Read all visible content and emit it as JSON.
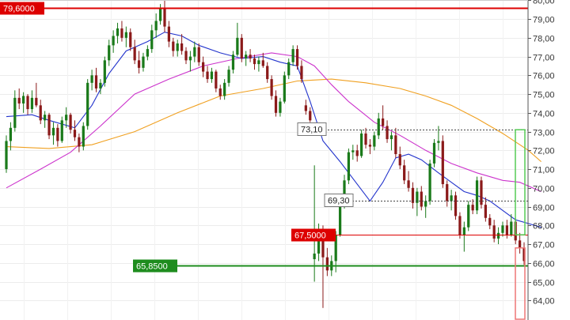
{
  "chart_data": {
    "type": "candlestick",
    "ylim": [
      63.0,
      80.1
    ],
    "y_ticks": [
      "64,00",
      "65,00",
      "66,00",
      "67,00",
      "68,00",
      "69,00",
      "70,00",
      "71,00",
      "72,00",
      "73,00",
      "74,00",
      "75,00",
      "76,00",
      "77,00",
      "78,00",
      "79,00",
      "80,00"
    ],
    "grid": true,
    "colors": {
      "up": "#1a7a1a",
      "down": "#8b1a1a",
      "sma_short": "#2233cc",
      "sma_mid": "#cc33cc",
      "sma_long": "#f0a020"
    },
    "annotations": {
      "resistance_high": {
        "value": 79.6,
        "label": "79,6000",
        "color": "#dd0000"
      },
      "resistance_mid": {
        "value": 67.5,
        "label": "67,5000",
        "color": "#dd0000"
      },
      "support": {
        "value": 65.85,
        "label": "65,8500",
        "color": "#1e8c1e"
      },
      "level_high": {
        "value": 73.1,
        "label": "73,10"
      },
      "level_low": {
        "value": 69.3,
        "label": "69,30"
      }
    },
    "candles": [
      [
        71.0,
        72.8,
        70.8,
        72.5
      ],
      [
        72.5,
        73.5,
        72.0,
        73.2
      ],
      [
        73.2,
        75.2,
        73.0,
        74.8
      ],
      [
        74.8,
        75.3,
        74.2,
        74.5
      ],
      [
        74.5,
        75.1,
        74.0,
        74.9
      ],
      [
        74.9,
        75.0,
        73.9,
        74.2
      ],
      [
        74.2,
        75.2,
        74.0,
        74.8
      ],
      [
        74.8,
        75.6,
        74.3,
        74.4
      ],
      [
        74.4,
        74.7,
        73.4,
        73.6
      ],
      [
        73.6,
        74.1,
        73.2,
        73.9
      ],
      [
        73.9,
        74.0,
        72.6,
        72.8
      ],
      [
        72.8,
        73.5,
        72.3,
        73.2
      ],
      [
        73.2,
        73.4,
        72.2,
        72.5
      ],
      [
        72.5,
        73.8,
        72.4,
        73.6
      ],
      [
        73.6,
        74.3,
        73.2,
        73.9
      ],
      [
        73.9,
        74.0,
        72.9,
        73.1
      ],
      [
        73.1,
        73.6,
        72.5,
        72.7
      ],
      [
        72.7,
        72.9,
        71.9,
        72.2
      ],
      [
        72.2,
        73.5,
        72.0,
        73.3
      ],
      [
        73.3,
        75.8,
        73.1,
        75.6
      ],
      [
        75.6,
        76.3,
        75.2,
        76.0
      ],
      [
        76.0,
        76.4,
        75.1,
        75.3
      ],
      [
        75.3,
        75.8,
        75.0,
        75.6
      ],
      [
        75.6,
        77.0,
        75.4,
        76.8
      ],
      [
        76.8,
        77.9,
        76.5,
        77.6
      ],
      [
        77.6,
        78.4,
        77.2,
        78.1
      ],
      [
        78.1,
        78.8,
        77.7,
        78.5
      ],
      [
        78.5,
        78.9,
        77.8,
        78.0
      ],
      [
        78.0,
        78.6,
        77.5,
        78.3
      ],
      [
        78.3,
        78.5,
        77.3,
        77.5
      ],
      [
        77.5,
        77.9,
        76.6,
        76.8
      ],
      [
        76.8,
        77.3,
        76.1,
        76.4
      ],
      [
        76.4,
        77.2,
        76.2,
        77.0
      ],
      [
        77.0,
        77.6,
        76.8,
        77.4
      ],
      [
        77.4,
        78.7,
        77.2,
        78.4
      ],
      [
        78.4,
        79.3,
        78.0,
        78.9
      ],
      [
        78.9,
        79.8,
        78.7,
        79.6
      ],
      [
        79.6,
        80.2,
        78.3,
        78.6
      ],
      [
        78.6,
        78.9,
        77.5,
        77.8
      ],
      [
        77.8,
        78.0,
        77.0,
        77.3
      ],
      [
        77.3,
        77.9,
        77.0,
        77.7
      ],
      [
        77.7,
        78.2,
        77.1,
        77.3
      ],
      [
        77.3,
        77.5,
        76.6,
        76.8
      ],
      [
        76.8,
        77.3,
        76.2,
        77.0
      ],
      [
        77.0,
        77.8,
        76.7,
        77.5
      ],
      [
        77.5,
        77.7,
        76.5,
        76.7
      ],
      [
        76.7,
        77.0,
        75.9,
        76.2
      ],
      [
        76.2,
        76.5,
        75.6,
        75.8
      ],
      [
        75.8,
        76.4,
        75.6,
        76.2
      ],
      [
        76.2,
        76.3,
        75.1,
        75.3
      ],
      [
        75.3,
        75.5,
        74.7,
        74.9
      ],
      [
        74.9,
        75.8,
        74.7,
        75.6
      ],
      [
        75.6,
        76.5,
        75.4,
        76.3
      ],
      [
        76.3,
        77.3,
        76.1,
        77.1
      ],
      [
        77.1,
        78.8,
        77.0,
        78.0
      ],
      [
        78.0,
        78.2,
        76.7,
        76.9
      ],
      [
        76.9,
        77.3,
        76.5,
        77.1
      ],
      [
        77.1,
        77.4,
        76.7,
        76.9
      ],
      [
        76.9,
        77.1,
        76.3,
        76.6
      ],
      [
        76.6,
        77.0,
        76.2,
        76.8
      ],
      [
        76.8,
        77.2,
        76.4,
        76.5
      ],
      [
        76.5,
        76.7,
        75.6,
        75.8
      ],
      [
        75.8,
        76.0,
        74.7,
        74.9
      ],
      [
        74.9,
        75.2,
        73.8,
        74.0
      ],
      [
        74.0,
        74.8,
        73.8,
        74.6
      ],
      [
        74.6,
        76.2,
        74.5,
        76.0
      ],
      [
        76.0,
        76.9,
        75.8,
        76.7
      ],
      [
        76.7,
        77.6,
        76.5,
        77.4
      ],
      [
        77.4,
        77.6,
        76.3,
        76.5
      ],
      [
        76.5,
        76.8,
        75.6,
        75.8
      ],
      [
        74.4,
        74.7,
        73.9,
        74.1
      ],
      [
        74.1,
        74.3,
        73.5,
        73.6
      ],
      [
        66.2,
        71.2,
        65.0,
        66.5
      ],
      [
        66.5,
        68.1,
        66.1,
        67.8
      ],
      [
        67.8,
        68.0,
        63.6,
        66.3
      ],
      [
        66.3,
        66.8,
        65.3,
        65.6
      ],
      [
        65.6,
        66.4,
        65.3,
        66.1
      ],
      [
        66.1,
        67.7,
        65.5,
        67.5
      ],
      [
        67.5,
        69.5,
        67.4,
        69.2
      ],
      [
        69.2,
        70.7,
        68.9,
        70.4
      ],
      [
        70.4,
        72.1,
        70.2,
        71.9
      ],
      [
        71.9,
        72.3,
        71.5,
        72.0
      ],
      [
        72.0,
        72.3,
        71.4,
        71.7
      ],
      [
        71.7,
        73.1,
        71.6,
        72.9
      ],
      [
        72.9,
        73.2,
        72.1,
        72.3
      ],
      [
        72.3,
        72.6,
        71.8,
        72.2
      ],
      [
        72.2,
        73.0,
        72.0,
        72.8
      ],
      [
        72.8,
        74.0,
        72.6,
        73.7
      ],
      [
        73.7,
        74.4,
        73.1,
        73.3
      ],
      [
        73.3,
        73.6,
        72.4,
        72.6
      ],
      [
        72.6,
        73.0,
        72.0,
        72.8
      ],
      [
        72.8,
        73.2,
        71.6,
        71.8
      ],
      [
        71.8,
        72.2,
        71.0,
        71.2
      ],
      [
        71.2,
        71.5,
        70.2,
        70.4
      ],
      [
        70.4,
        70.9,
        69.8,
        70.0
      ],
      [
        70.0,
        70.3,
        68.9,
        69.2
      ],
      [
        69.2,
        70.0,
        68.5,
        69.8
      ],
      [
        69.8,
        70.1,
        68.8,
        69.0
      ],
      [
        69.0,
        69.6,
        68.4,
        69.3
      ],
      [
        69.3,
        71.5,
        69.1,
        71.3
      ],
      [
        71.3,
        72.6,
        71.1,
        72.4
      ],
      [
        72.4,
        73.3,
        72.0,
        72.5
      ],
      [
        72.5,
        72.8,
        70.0,
        70.2
      ],
      [
        70.2,
        70.4,
        69.0,
        69.3
      ],
      [
        69.3,
        69.9,
        68.8,
        69.6
      ],
      [
        69.6,
        69.8,
        68.3,
        68.5
      ],
      [
        68.5,
        68.7,
        67.3,
        67.5
      ],
      [
        67.5,
        68.2,
        66.6,
        67.9
      ],
      [
        67.9,
        69.3,
        67.7,
        69.1
      ],
      [
        69.1,
        69.4,
        68.6,
        68.8
      ],
      [
        68.8,
        70.6,
        68.6,
        70.4
      ],
      [
        70.4,
        70.6,
        68.9,
        69.1
      ],
      [
        69.1,
        69.5,
        68.2,
        68.4
      ],
      [
        68.4,
        68.6,
        67.8,
        68.0
      ],
      [
        68.0,
        68.3,
        67.1,
        67.3
      ],
      [
        67.3,
        67.9,
        67.0,
        67.6
      ],
      [
        67.6,
        68.2,
        67.4,
        68.0
      ],
      [
        68.0,
        68.3,
        67.3,
        67.5
      ],
      [
        67.5,
        68.6,
        67.4,
        68.2
      ],
      [
        68.2,
        68.4,
        67.0,
        67.2
      ],
      [
        67.2,
        67.6,
        66.5,
        66.8
      ],
      [
        66.8,
        67.1,
        65.9,
        66.1
      ]
    ],
    "sma_short": [
      [
        0,
        73.8
      ],
      [
        6,
        73.9
      ],
      [
        10,
        73.6
      ],
      [
        16,
        73.2
      ],
      [
        20,
        74.4
      ],
      [
        24,
        76.1
      ],
      [
        28,
        77.3
      ],
      [
        33,
        77.8
      ],
      [
        37,
        78.3
      ],
      [
        41,
        78.1
      ],
      [
        45,
        77.6
      ],
      [
        50,
        77.2
      ],
      [
        55,
        76.9
      ],
      [
        60,
        77.0
      ],
      [
        64,
        76.7
      ],
      [
        68,
        76.5
      ],
      [
        71,
        74.6
      ],
      [
        74,
        72.5
      ],
      [
        78,
        71.4
      ],
      [
        82,
        70.2
      ],
      [
        85,
        69.3
      ],
      [
        88,
        70.3
      ],
      [
        91,
        71.6
      ],
      [
        94,
        71.8
      ],
      [
        97,
        71.5
      ],
      [
        101,
        70.8
      ],
      [
        104,
        70.3
      ],
      [
        107,
        69.8
      ],
      [
        110,
        69.6
      ],
      [
        113,
        69.3
      ],
      [
        116,
        68.8
      ],
      [
        119,
        68.3
      ],
      [
        122,
        68.1
      ],
      [
        125,
        67.9
      ]
    ],
    "sma_mid": [
      [
        0,
        70.0
      ],
      [
        8,
        71.0
      ],
      [
        15,
        71.9
      ],
      [
        22,
        73.3
      ],
      [
        30,
        75.0
      ],
      [
        38,
        75.8
      ],
      [
        46,
        76.5
      ],
      [
        54,
        76.9
      ],
      [
        62,
        77.2
      ],
      [
        68,
        77.0
      ],
      [
        72,
        76.5
      ],
      [
        76,
        75.5
      ],
      [
        80,
        74.6
      ],
      [
        86,
        73.5
      ],
      [
        92,
        72.8
      ],
      [
        98,
        72.0
      ],
      [
        104,
        71.3
      ],
      [
        110,
        70.8
      ],
      [
        116,
        70.4
      ],
      [
        120,
        70.3
      ],
      [
        125,
        69.8
      ]
    ],
    "sma_long": [
      [
        0,
        72.2
      ],
      [
        10,
        72.1
      ],
      [
        20,
        72.3
      ],
      [
        30,
        73.0
      ],
      [
        40,
        74.0
      ],
      [
        50,
        74.9
      ],
      [
        60,
        75.3
      ],
      [
        68,
        75.7
      ],
      [
        76,
        75.8
      ],
      [
        84,
        75.6
      ],
      [
        92,
        75.3
      ],
      [
        98,
        74.9
      ],
      [
        104,
        74.4
      ],
      [
        110,
        73.7
      ],
      [
        116,
        72.9
      ],
      [
        122,
        72.0
      ],
      [
        125,
        71.4
      ]
    ],
    "right_markers": [
      {
        "from": 67.5,
        "to": 73.1,
        "color": "#55cc55"
      },
      {
        "from": 63.0,
        "to": 66.8,
        "color": "#ee7777"
      }
    ]
  }
}
